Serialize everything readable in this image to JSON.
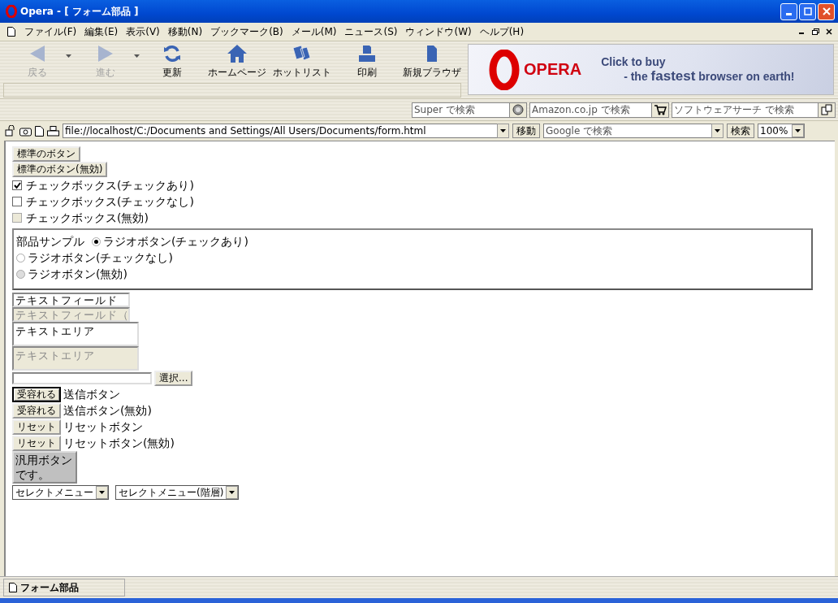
{
  "window": {
    "title": "Opera - [ フォーム部品 ]"
  },
  "menu": [
    "ファイル(F)",
    "編集(E)",
    "表示(V)",
    "移動(N)",
    "ブックマーク(B)",
    "メール(M)",
    "ニュース(S)",
    "ウィンドウ(W)",
    "ヘルプ(H)"
  ],
  "toolbar": [
    {
      "kind": "back",
      "label": "戻る",
      "disabled": true,
      "dropdown": true
    },
    {
      "kind": "forward",
      "label": "進む",
      "disabled": true,
      "dropdown": true
    },
    {
      "kind": "reload",
      "label": "更新",
      "disabled": false,
      "dropdown": false
    },
    {
      "kind": "home",
      "label": "ホームページ",
      "disabled": false,
      "dropdown": false
    },
    {
      "kind": "hotlist",
      "label": "ホットリスト",
      "disabled": false,
      "dropdown": false
    },
    {
      "kind": "print",
      "label": "印刷",
      "disabled": false,
      "dropdown": false
    },
    {
      "kind": "new",
      "label": "新規ブラウザ",
      "disabled": false,
      "dropdown": false
    }
  ],
  "banner": {
    "logo": "OPERA",
    "line1": "Click to buy",
    "line2": "- the **fastest** browser on earth!"
  },
  "search_fields": [
    {
      "kind": "super",
      "placeholder": "Super で検索"
    },
    {
      "kind": "cart",
      "placeholder": "Amazon.co.jp で検索"
    },
    {
      "kind": "software",
      "placeholder": "ソフトウェアサーチ で検索"
    }
  ],
  "address_bar": {
    "value": "file://localhost/C:/Documents and Settings/All Users/Documents/form.html",
    "go_button": "移動",
    "search_placeholder": "Google で検索",
    "search_button": "検索",
    "zoom": "100%"
  },
  "form": [
    {
      "kind": "button",
      "label": "標準のボタン"
    },
    {
      "kind": "button",
      "label": "標準のボタン(無効)"
    },
    {
      "kind": "checkbox",
      "label": "チェックボックス(チェックあり)",
      "checked": true,
      "disabled": false
    },
    {
      "kind": "checkbox",
      "label": "チェックボックス(チェックなし)",
      "checked": false,
      "disabled": false
    },
    {
      "kind": "checkbox",
      "label": "チェックボックス(無効)",
      "checked": false,
      "disabled": true
    },
    {
      "kind": "fieldset",
      "legend": "部品サンプル",
      "radios": [
        {
          "label": "ラジオボタン(チェックあり)",
          "selected": true,
          "disabled": false
        },
        {
          "label": "ラジオボタン(チェックなし)",
          "selected": false,
          "disabled": false
        },
        {
          "label": "ラジオボタン(無効)",
          "selected": false,
          "disabled": true
        }
      ]
    },
    {
      "kind": "textfield",
      "value": "テキストフィールド",
      "disabled": false
    },
    {
      "kind": "textfield",
      "value": "テキストフィールド（",
      "disabled": true
    },
    {
      "kind": "textarea",
      "value": "テキストエリア",
      "disabled": false
    },
    {
      "kind": "textarea",
      "value": "テキストエリア",
      "disabled": true
    },
    {
      "kind": "file",
      "button": "選択..."
    },
    {
      "kind": "submit",
      "button": "受容れる",
      "label": "送信ボタン",
      "focused": true
    },
    {
      "kind": "submit",
      "button": "受容れる",
      "label": "送信ボタン(無効)",
      "focused": false
    },
    {
      "kind": "submit",
      "button": "リセット",
      "label": "リセットボタン",
      "focused": false
    },
    {
      "kind": "submit",
      "button": "リセット",
      "label": "リセットボタン(無効)",
      "focused": false
    },
    {
      "kind": "generic",
      "label": "汎用ボタンです。"
    },
    {
      "kind": "selects",
      "items": [
        "セレクトメニュー",
        "セレクトメニュー(階層)"
      ]
    }
  ],
  "status_bar": {
    "tab": "フォーム部品"
  }
}
